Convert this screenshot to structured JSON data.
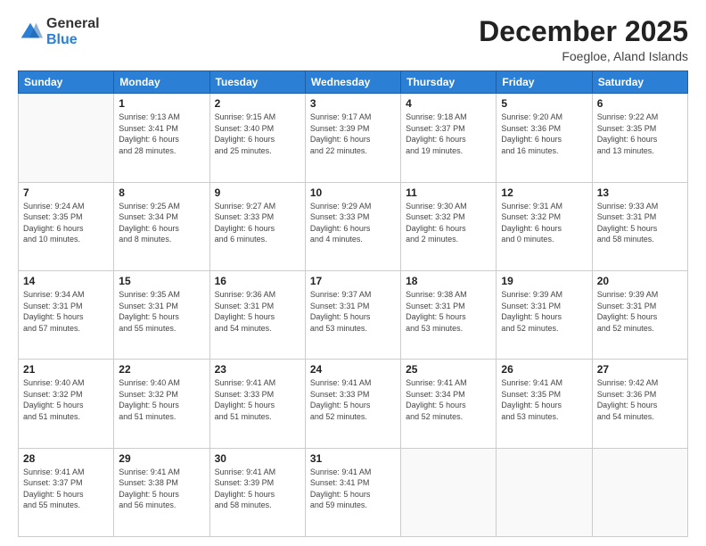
{
  "logo": {
    "general": "General",
    "blue": "Blue"
  },
  "header": {
    "month": "December 2025",
    "location": "Foegloe, Aland Islands"
  },
  "weekdays": [
    "Sunday",
    "Monday",
    "Tuesday",
    "Wednesday",
    "Thursday",
    "Friday",
    "Saturday"
  ],
  "weeks": [
    [
      {
        "day": "",
        "info": ""
      },
      {
        "day": "1",
        "info": "Sunrise: 9:13 AM\nSunset: 3:41 PM\nDaylight: 6 hours\nand 28 minutes."
      },
      {
        "day": "2",
        "info": "Sunrise: 9:15 AM\nSunset: 3:40 PM\nDaylight: 6 hours\nand 25 minutes."
      },
      {
        "day": "3",
        "info": "Sunrise: 9:17 AM\nSunset: 3:39 PM\nDaylight: 6 hours\nand 22 minutes."
      },
      {
        "day": "4",
        "info": "Sunrise: 9:18 AM\nSunset: 3:37 PM\nDaylight: 6 hours\nand 19 minutes."
      },
      {
        "day": "5",
        "info": "Sunrise: 9:20 AM\nSunset: 3:36 PM\nDaylight: 6 hours\nand 16 minutes."
      },
      {
        "day": "6",
        "info": "Sunrise: 9:22 AM\nSunset: 3:35 PM\nDaylight: 6 hours\nand 13 minutes."
      }
    ],
    [
      {
        "day": "7",
        "info": "Sunrise: 9:24 AM\nSunset: 3:35 PM\nDaylight: 6 hours\nand 10 minutes."
      },
      {
        "day": "8",
        "info": "Sunrise: 9:25 AM\nSunset: 3:34 PM\nDaylight: 6 hours\nand 8 minutes."
      },
      {
        "day": "9",
        "info": "Sunrise: 9:27 AM\nSunset: 3:33 PM\nDaylight: 6 hours\nand 6 minutes."
      },
      {
        "day": "10",
        "info": "Sunrise: 9:29 AM\nSunset: 3:33 PM\nDaylight: 6 hours\nand 4 minutes."
      },
      {
        "day": "11",
        "info": "Sunrise: 9:30 AM\nSunset: 3:32 PM\nDaylight: 6 hours\nand 2 minutes."
      },
      {
        "day": "12",
        "info": "Sunrise: 9:31 AM\nSunset: 3:32 PM\nDaylight: 6 hours\nand 0 minutes."
      },
      {
        "day": "13",
        "info": "Sunrise: 9:33 AM\nSunset: 3:31 PM\nDaylight: 5 hours\nand 58 minutes."
      }
    ],
    [
      {
        "day": "14",
        "info": "Sunrise: 9:34 AM\nSunset: 3:31 PM\nDaylight: 5 hours\nand 57 minutes."
      },
      {
        "day": "15",
        "info": "Sunrise: 9:35 AM\nSunset: 3:31 PM\nDaylight: 5 hours\nand 55 minutes."
      },
      {
        "day": "16",
        "info": "Sunrise: 9:36 AM\nSunset: 3:31 PM\nDaylight: 5 hours\nand 54 minutes."
      },
      {
        "day": "17",
        "info": "Sunrise: 9:37 AM\nSunset: 3:31 PM\nDaylight: 5 hours\nand 53 minutes."
      },
      {
        "day": "18",
        "info": "Sunrise: 9:38 AM\nSunset: 3:31 PM\nDaylight: 5 hours\nand 53 minutes."
      },
      {
        "day": "19",
        "info": "Sunrise: 9:39 AM\nSunset: 3:31 PM\nDaylight: 5 hours\nand 52 minutes."
      },
      {
        "day": "20",
        "info": "Sunrise: 9:39 AM\nSunset: 3:31 PM\nDaylight: 5 hours\nand 52 minutes."
      }
    ],
    [
      {
        "day": "21",
        "info": "Sunrise: 9:40 AM\nSunset: 3:32 PM\nDaylight: 5 hours\nand 51 minutes."
      },
      {
        "day": "22",
        "info": "Sunrise: 9:40 AM\nSunset: 3:32 PM\nDaylight: 5 hours\nand 51 minutes."
      },
      {
        "day": "23",
        "info": "Sunrise: 9:41 AM\nSunset: 3:33 PM\nDaylight: 5 hours\nand 51 minutes."
      },
      {
        "day": "24",
        "info": "Sunrise: 9:41 AM\nSunset: 3:33 PM\nDaylight: 5 hours\nand 52 minutes."
      },
      {
        "day": "25",
        "info": "Sunrise: 9:41 AM\nSunset: 3:34 PM\nDaylight: 5 hours\nand 52 minutes."
      },
      {
        "day": "26",
        "info": "Sunrise: 9:41 AM\nSunset: 3:35 PM\nDaylight: 5 hours\nand 53 minutes."
      },
      {
        "day": "27",
        "info": "Sunrise: 9:42 AM\nSunset: 3:36 PM\nDaylight: 5 hours\nand 54 minutes."
      }
    ],
    [
      {
        "day": "28",
        "info": "Sunrise: 9:41 AM\nSunset: 3:37 PM\nDaylight: 5 hours\nand 55 minutes."
      },
      {
        "day": "29",
        "info": "Sunrise: 9:41 AM\nSunset: 3:38 PM\nDaylight: 5 hours\nand 56 minutes."
      },
      {
        "day": "30",
        "info": "Sunrise: 9:41 AM\nSunset: 3:39 PM\nDaylight: 5 hours\nand 58 minutes."
      },
      {
        "day": "31",
        "info": "Sunrise: 9:41 AM\nSunset: 3:41 PM\nDaylight: 5 hours\nand 59 minutes."
      },
      {
        "day": "",
        "info": ""
      },
      {
        "day": "",
        "info": ""
      },
      {
        "day": "",
        "info": ""
      }
    ]
  ]
}
